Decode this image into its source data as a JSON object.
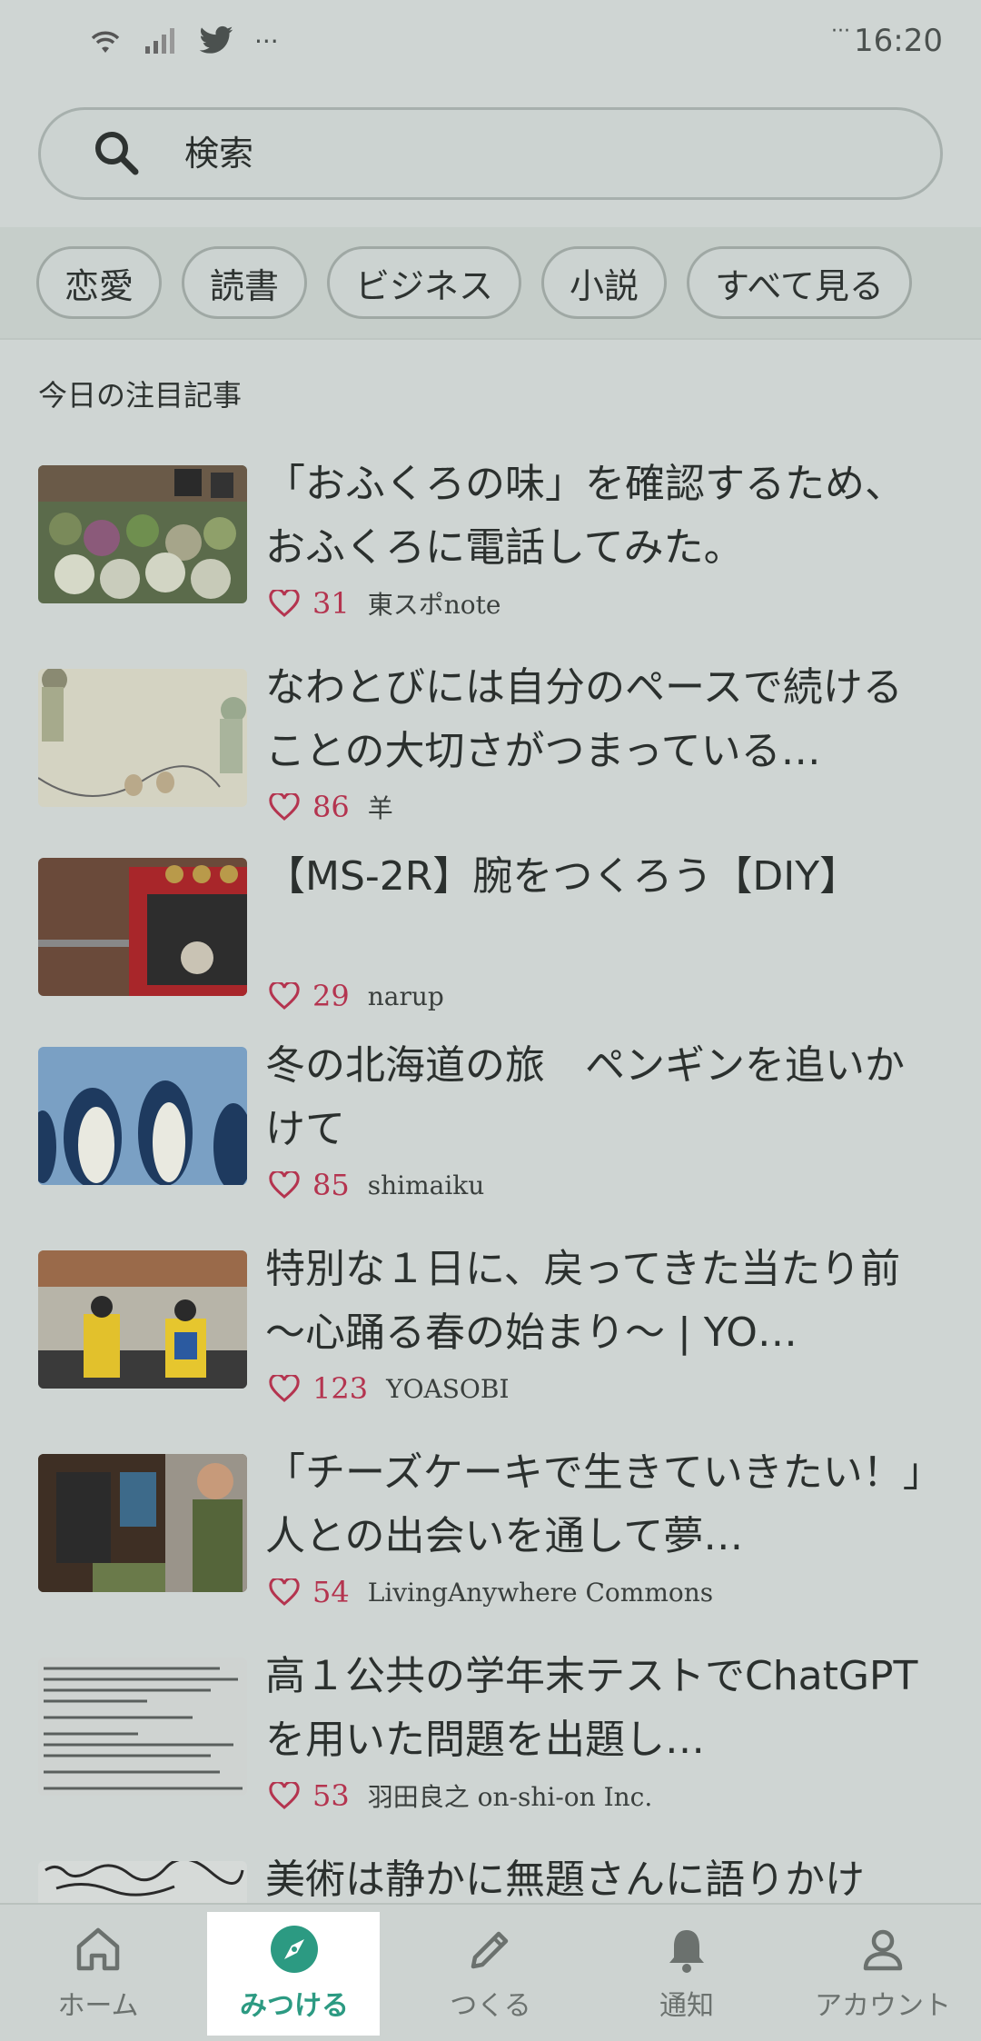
{
  "status_bar": {
    "time": "16:20",
    "icons": [
      "wifi-icon",
      "signal-icon",
      "twitter-icon",
      "more-dots-icon"
    ]
  },
  "search": {
    "placeholder": "検索"
  },
  "categories": [
    "恋愛",
    "読書",
    "ビジネス",
    "小説",
    "すべて見る"
  ],
  "section_title": "今日の注目記事",
  "articles": [
    {
      "title": "「おふくろの味」を確認するため、おふくろに電話してみた。",
      "likes": "31",
      "author": "東スポnote"
    },
    {
      "title": "なわとびには自分のペースで続けることの大切さがつまっている…",
      "likes": "86",
      "author": "羊"
    },
    {
      "title": "【MS-2R】腕をつくろう【DIY】",
      "likes": "29",
      "author": "narup"
    },
    {
      "title": "冬の北海道の旅　ペンギンを追いかけて",
      "likes": "85",
      "author": "shimaiku"
    },
    {
      "title": "特別な１日に、戻ってきた当たり前 〜心踊る春の始まり〜 | YO…",
      "likes": "123",
      "author": "YOASOBI"
    },
    {
      "title": "「チーズケーキで生きていきたい！」人との出会いを通して夢…",
      "likes": "54",
      "author": "LivingAnywhere Commons"
    },
    {
      "title": "高１公共の学年末テストでChatGPTを用いた問題を出題し…",
      "likes": "53",
      "author": "羽田良之 on-shi-on Inc."
    },
    {
      "title": "美術は静かに無題さんに語りかけ",
      "likes": "",
      "author": ""
    }
  ],
  "nav": {
    "home": "ホーム",
    "discover": "みつける",
    "create": "つくる",
    "notifications": "通知",
    "account": "アカウント"
  },
  "colors": {
    "accent": "#2c9a82",
    "like": "#b4344f"
  }
}
